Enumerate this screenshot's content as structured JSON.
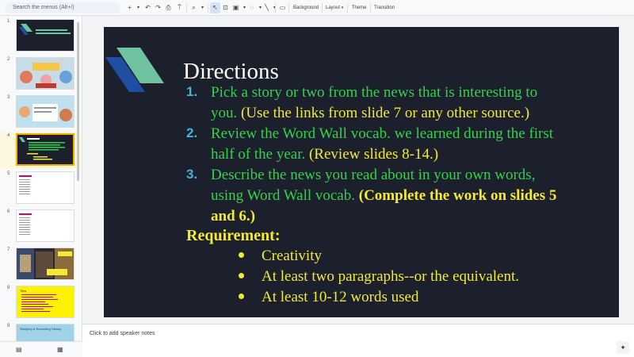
{
  "search": {
    "placeholder": "Search the menus (Alt+/)"
  },
  "toolbar": {
    "new_slide": "+",
    "background": "Background",
    "layout": "Layout",
    "theme": "Theme",
    "transition": "Transition"
  },
  "filmstrip": {
    "slide_numbers": [
      "1",
      "2",
      "3",
      "4",
      "5",
      "6",
      "7",
      "8",
      "9"
    ],
    "selected_slide": 4,
    "slide8_label": "Tiles",
    "slide9_label": "Studying & Recording History"
  },
  "slide": {
    "title": "Directions",
    "items": [
      {
        "num": "1.",
        "line1": "Pick a story or two from the news that is interesting to",
        "line2a": "you.",
        "line2b": "(Use the links from slide 7 or any other source.)"
      },
      {
        "num": "2.",
        "line1": "Review the Word Wall vocab. we learned during the first",
        "line2a": "half of the year.",
        "line2b": "(Review slides 8-14.)"
      },
      {
        "num": "3.",
        "line1": "Describe the news you read about in your own words,",
        "line2a": "using Word Wall vocab.",
        "line2b": "(Complete the work on slides 5",
        "line3": "and 6.)"
      }
    ],
    "requirement_title": "Requirement:",
    "requirements": [
      "Creativity",
      "At least two paragraphs--or the equivalent.",
      "At least 10-12 words used"
    ]
  },
  "colors": {
    "slide_bg": "#1c202c",
    "green_text": "#33d24a",
    "yellow_text": "#f4e933",
    "number_blue": "#3fb5dc",
    "accent_dark_blue": "#1f4fa3",
    "accent_teal": "#6fc3a0"
  },
  "notes": {
    "placeholder": "Click to add speaker notes"
  }
}
